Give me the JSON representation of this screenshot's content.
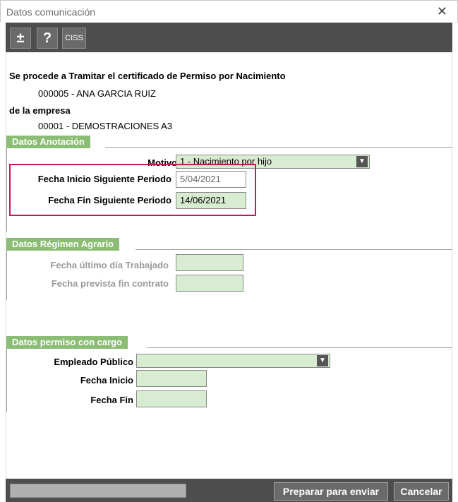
{
  "window": {
    "title": "Datos comunicación",
    "close_glyph": "✕"
  },
  "toolbar": {
    "plus_label": "±",
    "help_label": "?",
    "ciss_label": "CISS"
  },
  "intro": {
    "line1": "Se procede a Tramitar el certificado de Permiso por Nacimiento",
    "employee": "000005 - ANA GARCIA RUIZ",
    "line2": "de la empresa",
    "company": "00001 - DEMOSTRACIONES A3"
  },
  "anotacion": {
    "section_title": "Datos Anotación",
    "motivo_label": "Motivo",
    "motivo_value": "1 - Nacimiento por hijo",
    "fecha_inicio_label": "Fecha Inicio Siguiente Periodo",
    "fecha_inicio_value": "5/04/2021",
    "fecha_fin_label": "Fecha Fin Siguiente Periodo",
    "fecha_fin_value": "14/06/2021"
  },
  "agrario": {
    "section_title": "Datos Régimen Agrario",
    "ultimo_dia_label": "Fecha último día Trabajado",
    "fin_contrato_label": "Fecha prevista fin contrato"
  },
  "cargo": {
    "section_title": "Datos permiso con cargo",
    "empleado_label": "Empleado Público",
    "fecha_inicio_label": "Fecha Inicio",
    "fecha_fin_label": "Fecha Fin"
  },
  "footer": {
    "prepare_label": "Preparar para enviar",
    "cancel_label": "Cancelar"
  },
  "colors": {
    "accent_green": "#8bbd74",
    "field_green": "#d8ecd1",
    "highlight": "#c8185c",
    "bar": "#4d4d4d"
  }
}
